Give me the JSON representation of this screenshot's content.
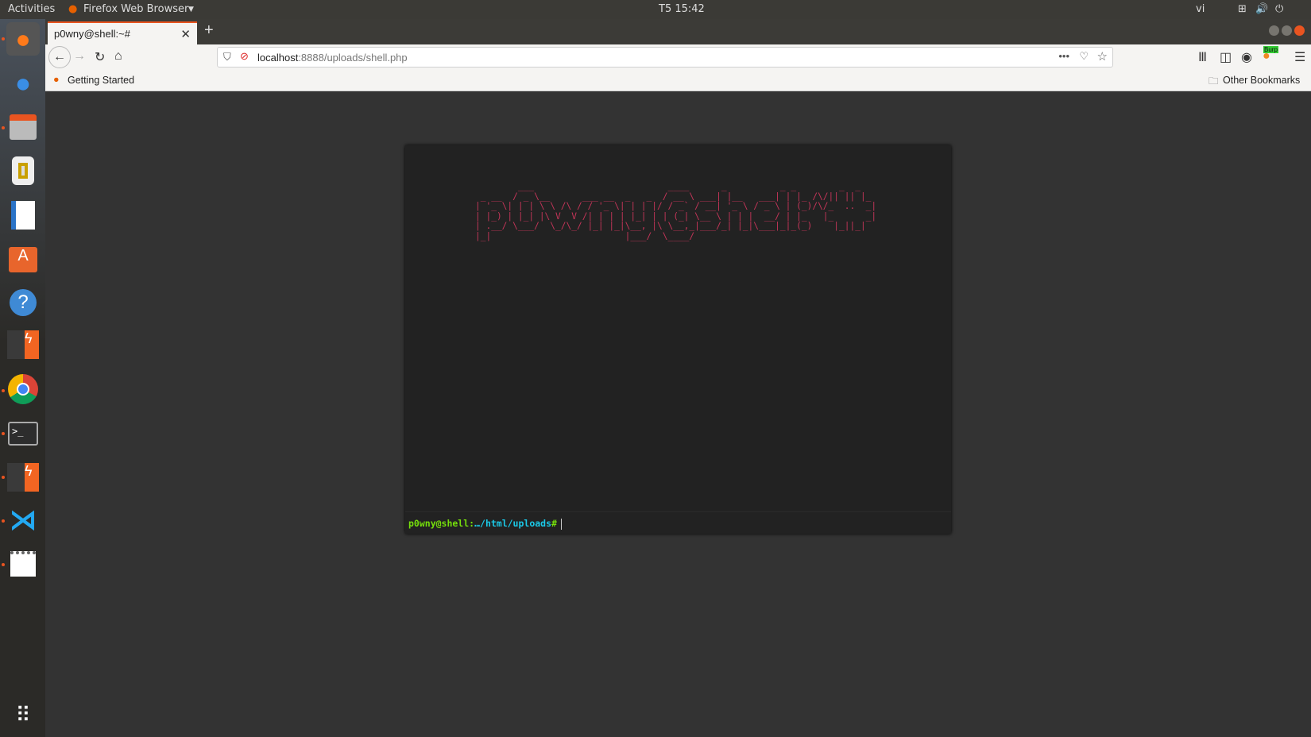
{
  "topbar": {
    "activities": "Activities",
    "app": "Firefox Web Browser",
    "clock": "T5 15:42",
    "lang": "vi"
  },
  "dock": [
    "firefox-icon",
    "thunderbird-icon",
    "files-icon",
    "rhythmbox-icon",
    "writer-icon",
    "software-icon",
    "help-icon",
    "burp-icon",
    "chrome-icon",
    "terminal-icon",
    "burp-icon",
    "vscode-icon",
    "text-editor-icon",
    "app-grid-icon"
  ],
  "browser": {
    "tab_title": "p0wny@shell:~#",
    "url_host": "localhost",
    "url_rest": ":8888/uploads/shell.php",
    "bookmark": "Getting Started",
    "other_bookmarks": "Other Bookmarks",
    "burp_badge": "Burp"
  },
  "shell": {
    "banner": "        ___                         ____      _          _ _        _  _   \n _ __  / _ \\__      ___ __  _   _  / __ \\ ___| |__   ___| | |_ /\\/|| || |_ \n| '_ \\| | | \\ \\ /\\ / / '_ \\| | | |/ / _` / __| '_ \\ / _ \\ | (_)/\\/_  ..  _|\n| |_) | |_| |\\ V  V /| | | | |_| | | (_| \\__ \\ | | |  __/ | |_   |_      _|\n| .__/ \\___/  \\_/\\_/ |_| |_|\\__, |\\ \\__,_|___/_| |_|\\___|_|_(_)    |_||_|  \n|_|                         |___/  \\____/                                  ",
    "prompt_user": "p0wny@shell:",
    "prompt_path": "…/html/uploads",
    "prompt_hash": "#"
  }
}
